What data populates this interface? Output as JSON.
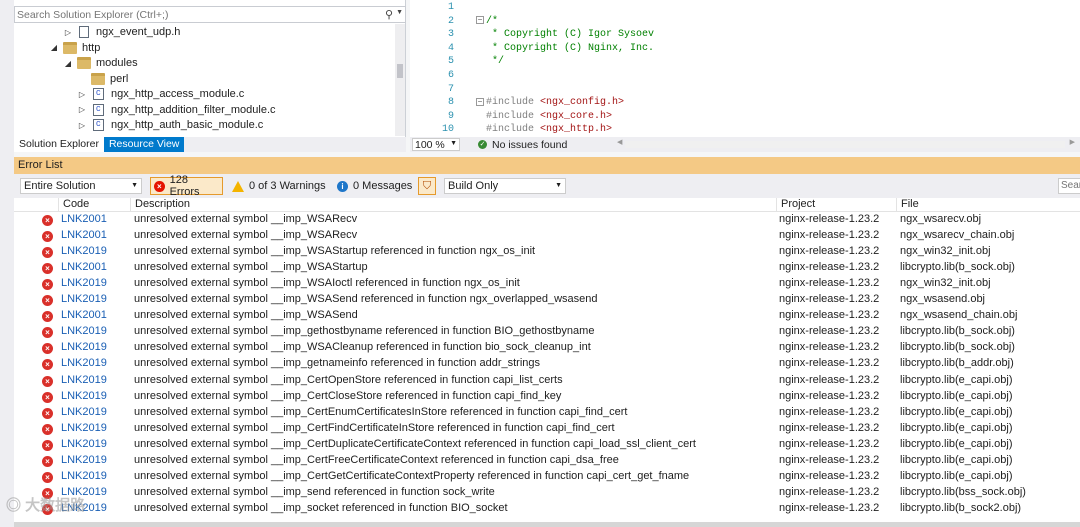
{
  "solution_explorer": {
    "search_placeholder": "Search Solution Explorer (Ctrl+;)",
    "tree": [
      {
        "label": "ngx_event_udp.h",
        "indent": 2,
        "expander": "▷",
        "icon": "file"
      },
      {
        "label": "http",
        "indent": 1,
        "expander": "◢",
        "icon": "folder"
      },
      {
        "label": "modules",
        "indent": 2,
        "expander": "◢",
        "icon": "folder"
      },
      {
        "label": "perl",
        "indent": 3,
        "expander": "",
        "icon": "folder"
      },
      {
        "label": "ngx_http_access_module.c",
        "indent": 3,
        "expander": "▷",
        "icon": "c-file"
      },
      {
        "label": "ngx_http_addition_filter_module.c",
        "indent": 3,
        "expander": "▷",
        "icon": "c-file"
      },
      {
        "label": "ngx_http_auth_basic_module.c",
        "indent": 3,
        "expander": "▷",
        "icon": "c-file"
      }
    ],
    "tabs": {
      "solution": "Solution Explorer",
      "resource": "Resource View"
    }
  },
  "editor": {
    "line_numbers": [
      "1",
      "2",
      "3",
      "4",
      "5",
      "6",
      "7",
      "8",
      "9",
      "10"
    ],
    "lines": [
      {
        "text": "",
        "kind": "plain"
      },
      {
        "text": "/*",
        "kind": "comment"
      },
      {
        "text": " * Copyright (C) Igor Sysoev",
        "kind": "comment"
      },
      {
        "text": " * Copyright (C) Nginx, Inc.",
        "kind": "comment"
      },
      {
        "text": " */",
        "kind": "comment"
      },
      {
        "text": "",
        "kind": "plain"
      },
      {
        "text": "",
        "kind": "plain"
      },
      {
        "text": "#include",
        "kind": "include",
        "arg": "<ngx_config.h>"
      },
      {
        "text": "#include",
        "kind": "include",
        "arg": "<ngx_core.h>"
      },
      {
        "text": "#include",
        "kind": "include",
        "arg": "<ngx_http.h>"
      }
    ],
    "zoom": "100 %",
    "status": "No issues found"
  },
  "error_list": {
    "title": "Error List",
    "scope": "Entire Solution",
    "errors_label": "128 Errors",
    "warnings_label": "0 of 3 Warnings",
    "messages_label": "0 Messages",
    "build_filter": "Build Only",
    "search_placeholder": "Sear",
    "columns": {
      "code": "Code",
      "description": "Description",
      "project": "Project",
      "file": "File"
    },
    "rows": [
      {
        "code": "LNK2001",
        "description": "unresolved external symbol __imp_WSARecv",
        "project": "nginx-release-1.23.2",
        "file": "ngx_wsarecv.obj"
      },
      {
        "code": "LNK2001",
        "description": "unresolved external symbol __imp_WSARecv",
        "project": "nginx-release-1.23.2",
        "file": "ngx_wsarecv_chain.obj"
      },
      {
        "code": "LNK2019",
        "description": "unresolved external symbol __imp_WSAStartup referenced in function ngx_os_init",
        "project": "nginx-release-1.23.2",
        "file": "ngx_win32_init.obj"
      },
      {
        "code": "LNK2001",
        "description": "unresolved external symbol __imp_WSAStartup",
        "project": "nginx-release-1.23.2",
        "file": "libcrypto.lib(b_sock.obj)"
      },
      {
        "code": "LNK2019",
        "description": "unresolved external symbol __imp_WSAIoctl referenced in function ngx_os_init",
        "project": "nginx-release-1.23.2",
        "file": "ngx_win32_init.obj"
      },
      {
        "code": "LNK2019",
        "description": "unresolved external symbol __imp_WSASend referenced in function ngx_overlapped_wsasend",
        "project": "nginx-release-1.23.2",
        "file": "ngx_wsasend.obj"
      },
      {
        "code": "LNK2001",
        "description": "unresolved external symbol __imp_WSASend",
        "project": "nginx-release-1.23.2",
        "file": "ngx_wsasend_chain.obj"
      },
      {
        "code": "LNK2019",
        "description": "unresolved external symbol __imp_gethostbyname referenced in function BIO_gethostbyname",
        "project": "nginx-release-1.23.2",
        "file": "libcrypto.lib(b_sock.obj)"
      },
      {
        "code": "LNK2019",
        "description": "unresolved external symbol __imp_WSACleanup referenced in function bio_sock_cleanup_int",
        "project": "nginx-release-1.23.2",
        "file": "libcrypto.lib(b_sock.obj)"
      },
      {
        "code": "LNK2019",
        "description": "unresolved external symbol __imp_getnameinfo referenced in function addr_strings",
        "project": "nginx-release-1.23.2",
        "file": "libcrypto.lib(b_addr.obj)"
      },
      {
        "code": "LNK2019",
        "description": "unresolved external symbol __imp_CertOpenStore referenced in function capi_list_certs",
        "project": "nginx-release-1.23.2",
        "file": "libcrypto.lib(e_capi.obj)"
      },
      {
        "code": "LNK2019",
        "description": "unresolved external symbol __imp_CertCloseStore referenced in function capi_find_key",
        "project": "nginx-release-1.23.2",
        "file": "libcrypto.lib(e_capi.obj)"
      },
      {
        "code": "LNK2019",
        "description": "unresolved external symbol __imp_CertEnumCertificatesInStore referenced in function capi_find_cert",
        "project": "nginx-release-1.23.2",
        "file": "libcrypto.lib(e_capi.obj)"
      },
      {
        "code": "LNK2019",
        "description": "unresolved external symbol __imp_CertFindCertificateInStore referenced in function capi_find_cert",
        "project": "nginx-release-1.23.2",
        "file": "libcrypto.lib(e_capi.obj)"
      },
      {
        "code": "LNK2019",
        "description": "unresolved external symbol __imp_CertDuplicateCertificateContext referenced in function capi_load_ssl_client_cert",
        "project": "nginx-release-1.23.2",
        "file": "libcrypto.lib(e_capi.obj)"
      },
      {
        "code": "LNK2019",
        "description": "unresolved external symbol __imp_CertFreeCertificateContext referenced in function capi_dsa_free",
        "project": "nginx-release-1.23.2",
        "file": "libcrypto.lib(e_capi.obj)"
      },
      {
        "code": "LNK2019",
        "description": "unresolved external symbol __imp_CertGetCertificateContextProperty referenced in function capi_cert_get_fname",
        "project": "nginx-release-1.23.2",
        "file": "libcrypto.lib(e_capi.obj)"
      },
      {
        "code": "LNK2019",
        "description": "unresolved external symbol __imp_send referenced in function sock_write",
        "project": "nginx-release-1.23.2",
        "file": "libcrypto.lib(bss_sock.obj)"
      },
      {
        "code": "LNK2019",
        "description": "unresolved external symbol __imp_socket referenced in function BIO_socket",
        "project": "nginx-release-1.23.2",
        "file": "libcrypto.lib(b_sock2.obj)"
      }
    ]
  },
  "watermark": "◎ 大数据路",
  "colors": {
    "accent": "#007acc",
    "error": "#d9302a",
    "error_list_title": "#f4c985",
    "link": "#1a5fb4"
  }
}
